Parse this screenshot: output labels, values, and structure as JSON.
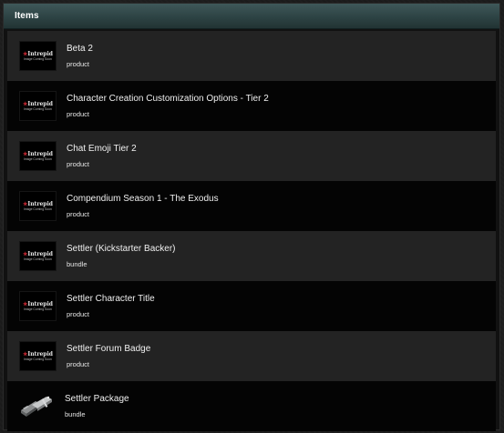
{
  "panel": {
    "title": "Items"
  },
  "thumbnail": {
    "brand": "Intrepid",
    "caption": "Image Coming Soon"
  },
  "items": [
    {
      "name": "Beta 2",
      "type": "product",
      "image": "placeholder"
    },
    {
      "name": "Character Creation Customization Options - Tier 2",
      "type": "product",
      "image": "placeholder"
    },
    {
      "name": "Chat Emoji Tier 2",
      "type": "product",
      "image": "placeholder"
    },
    {
      "name": "Compendium Season 1 - The Exodus",
      "type": "product",
      "image": "placeholder"
    },
    {
      "name": "Settler (Kickstarter Backer)",
      "type": "bundle",
      "image": "placeholder"
    },
    {
      "name": "Settler Character Title",
      "type": "product",
      "image": "placeholder"
    },
    {
      "name": "Settler Forum Badge",
      "type": "product",
      "image": "placeholder"
    },
    {
      "name": "Settler Package",
      "type": "bundle",
      "image": "package-icon"
    }
  ],
  "colors": {
    "header_gradient_top": "#3f5859",
    "header_gradient_bottom": "#223334",
    "row_light": "#232323",
    "row_dark": "#040404",
    "logo_mark": "#c0262f"
  }
}
